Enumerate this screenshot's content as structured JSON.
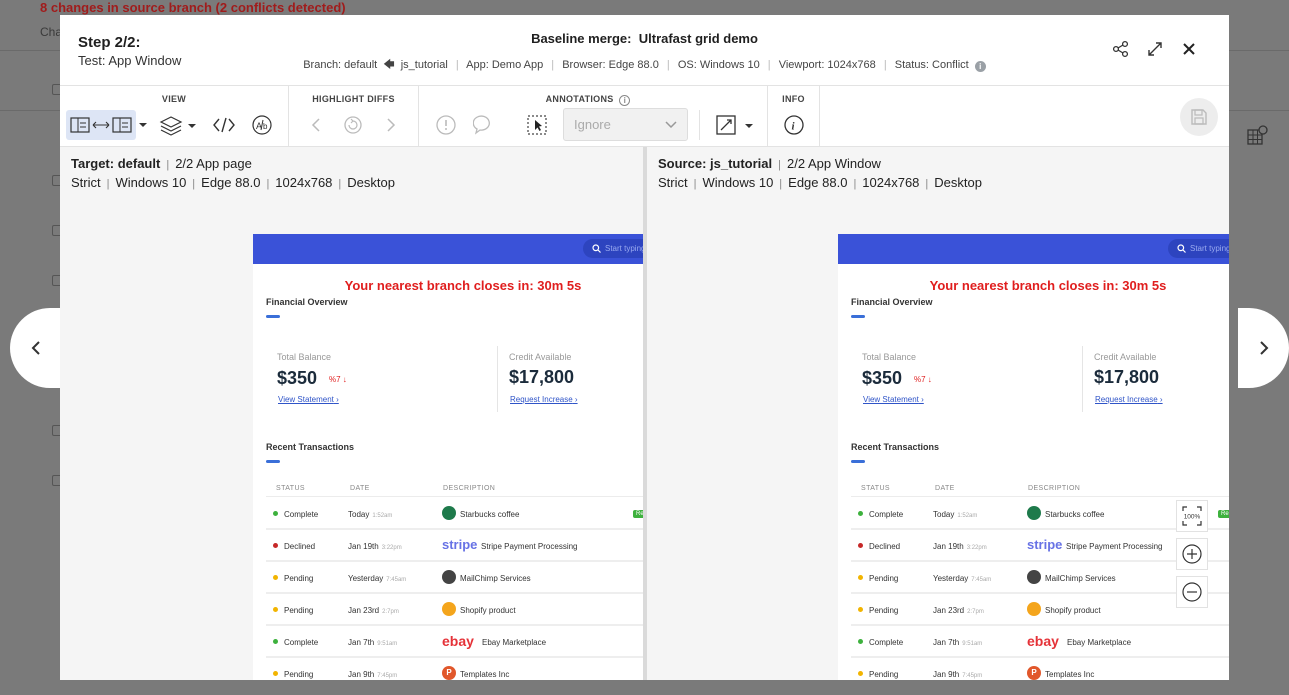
{
  "background": {
    "banner": "8 changes in source branch (2 conflicts detected)",
    "sub_label": "Cha"
  },
  "header": {
    "step": "Step 2/2:",
    "test_name": "Test: App Window",
    "merge_prefix": "Baseline merge:",
    "merge_name": "Ultrafast grid demo",
    "branch_label": "Branch: default",
    "source_branch": "js_tutorial",
    "app": "App: Demo App",
    "browser": "Browser: Edge 88.0",
    "os": "OS: Windows 10",
    "viewport": "Viewport: 1024x768",
    "status": "Status: Conflict"
  },
  "toolbar": {
    "view_label": "VIEW",
    "highlight_label": "HIGHLIGHT DIFFS",
    "annotations_label": "ANNOTATIONS",
    "info_label": "INFO",
    "ignore_select": "Ignore"
  },
  "left_pane": {
    "title": "Target: default",
    "step": "2/2 App page",
    "strict": "Strict",
    "os": "Windows 10",
    "browser": "Edge 88.0",
    "viewport": "1024x768",
    "device": "Desktop"
  },
  "right_pane": {
    "title": "Source: js_tutorial",
    "step": "2/2 App Window",
    "strict": "Strict",
    "os": "Windows 10",
    "browser": "Edge 88.0",
    "viewport": "1024x768",
    "device": "Desktop"
  },
  "app": {
    "search_placeholder": "Start typing",
    "alert": "Your nearest branch closes in: 30m 5s",
    "financial_overview": "Financial Overview",
    "total_balance_label": "Total Balance",
    "total_balance": "$350",
    "balance_change": "%7",
    "view_statement": "View Statement",
    "credit_label": "Credit Available",
    "credit_value": "$17,800",
    "request_increase": "Request Increase",
    "recent_transactions": "Recent Transactions",
    "columns": [
      "STATUS",
      "DATE",
      "DESCRIPTION"
    ],
    "rows": [
      {
        "status": "Complete",
        "date": "Today",
        "time": "1:52am",
        "desc": "Starbucks coffee",
        "status_color": "#3db13d",
        "logo_color": "#1e7a4b"
      },
      {
        "status": "Declined",
        "date": "Jan 19th",
        "time": "3:22pm",
        "desc": "Stripe Payment Processing",
        "status_color": "#c62828",
        "logo_text": "stripe",
        "logo_color": "#6772e5"
      },
      {
        "status": "Pending",
        "date": "Yesterday",
        "time": "7:45am",
        "desc": "MailChimp Services",
        "status_color": "#f2b400",
        "logo_color": "#444444"
      },
      {
        "status": "Pending",
        "date": "Jan 23rd",
        "time": "2:7pm",
        "desc": "Shopify product",
        "status_color": "#f2b400",
        "logo_color": "#f4a51c"
      },
      {
        "status": "Complete",
        "date": "Jan 7th",
        "time": "9:51am",
        "desc": "Ebay Marketplace",
        "status_color": "#3db13d",
        "logo_text": "ebay",
        "logo_color": "#e53238"
      },
      {
        "status": "Pending",
        "date": "Jan 9th",
        "time": "7:45pm",
        "desc": "Templates Inc",
        "status_color": "#f2b400",
        "logo_text": "P",
        "logo_color": "#e1572b"
      }
    ],
    "badge": "Re"
  },
  "zoom": {
    "fit_label": "100%"
  }
}
